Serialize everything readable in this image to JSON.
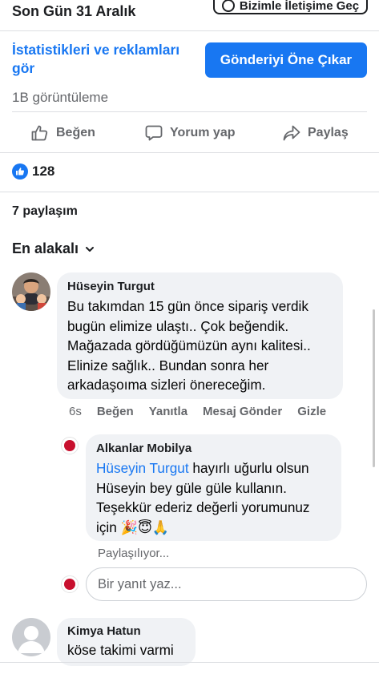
{
  "header": {
    "title": "Son Gün 31 Aralık",
    "whatsapp_button": "Bizimle İletişime Geç"
  },
  "promo": {
    "stats_link": "İstatistikleri ve reklamları gör",
    "boost_button": "Gönderiyi Öne Çıkar",
    "views": "1B görüntüleme"
  },
  "actions": {
    "like": "Beğen",
    "comment": "Yorum yap",
    "share": "Paylaş"
  },
  "reactions": {
    "count": "128"
  },
  "shares": "7 paylaşım",
  "sort_label": "En alakalı",
  "comments": [
    {
      "author": "Hüseyin Turgut",
      "text": "Bu takımdan 15 gün önce sipariş verdik bugün elimize ulaştı.. Çok beğendik. Mağazada gördüğümüzün aynı kalitesi.. Elinize sağlık.. Bundan sonra her arkadaşoıma sizleri önereceğim.",
      "time": "6s",
      "like": "Beğen",
      "reply": "Yanıtla",
      "message": "Mesaj Gönder",
      "hide": "Gizle"
    },
    {
      "author": "Alkanlar Mobilya",
      "mention": "Hüseyin Turgut",
      "text_after_mention": " hayırlı uğurlu olsun Hüseyin bey güle güle kullanın. Teşekkür ederiz değerli yorumunuz için 🎉😇🙏",
      "status": "Paylaşılıyor..."
    },
    {
      "author": "Kimya Hatun",
      "text": "köse takimi varmi"
    }
  ],
  "reply_input": {
    "placeholder": "Bir yanıt yaz..."
  },
  "colors": {
    "accent": "#1877f2",
    "secondary_text": "#65676b",
    "bubble": "#f0f2f5"
  }
}
